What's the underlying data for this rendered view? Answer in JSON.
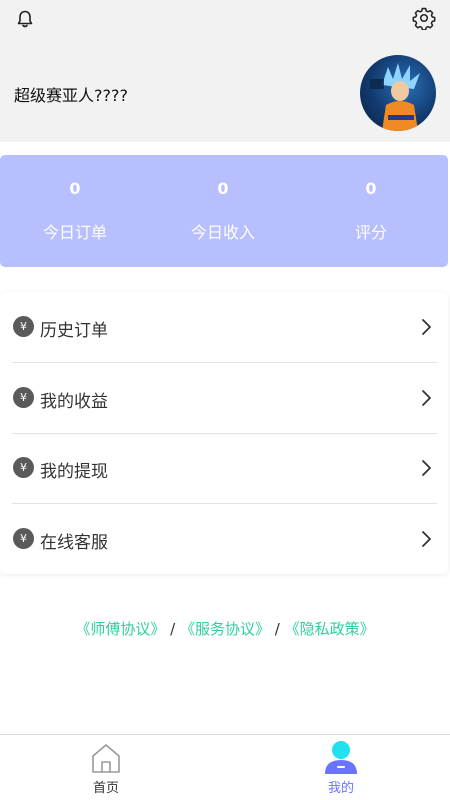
{
  "header": {
    "username": "超级赛亚人????",
    "icons": {
      "left": "bell-icon",
      "right": "gear-icon"
    }
  },
  "stats": [
    {
      "value": "0",
      "label": "今日订单"
    },
    {
      "value": "0",
      "label": "今日收入"
    },
    {
      "value": "0",
      "label": "评分"
    }
  ],
  "menu": {
    "items": [
      {
        "icon": "yen-icon",
        "icon_glyph": "¥",
        "label": "历史订单"
      },
      {
        "icon": "yen-icon",
        "icon_glyph": "¥",
        "label": "我的收益"
      },
      {
        "icon": "yen-icon",
        "icon_glyph": "¥",
        "label": "我的提现"
      },
      {
        "icon": "yen-icon",
        "icon_glyph": "¥",
        "label": "在线客服"
      }
    ]
  },
  "agreements": {
    "master": "《师傅协议》",
    "service": "《服务协议》",
    "privacy": "《隐私政策》",
    "separator": "/"
  },
  "tabbar": {
    "home": "首页",
    "mine": "我的",
    "active": "mine"
  },
  "colors": {
    "header_bg": "#f2f2f2",
    "stats_bg": "#b7bfff",
    "link": "#2fcf9f",
    "tab_active": "#6b74ff",
    "tab_inactive": "#333333"
  }
}
